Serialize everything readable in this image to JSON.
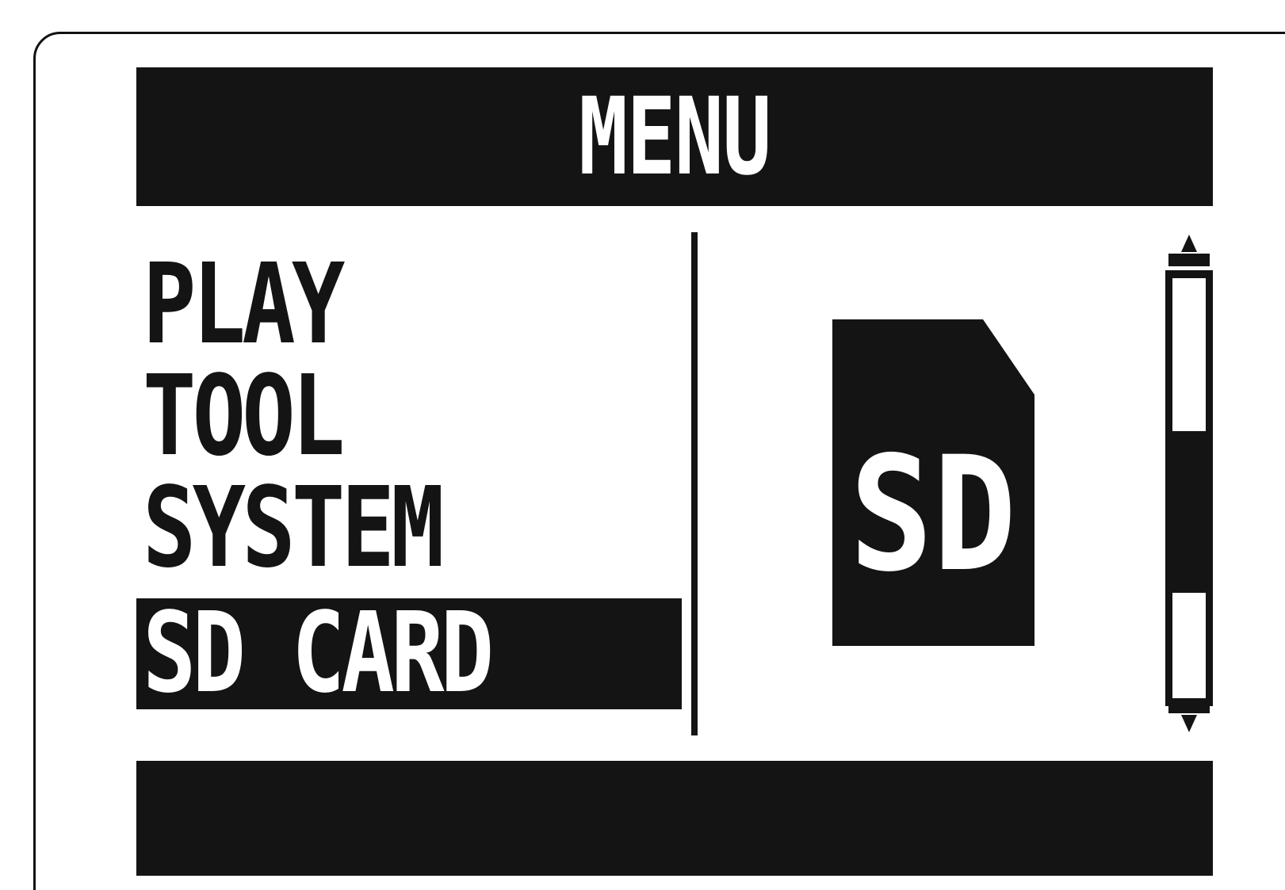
{
  "header": {
    "title": "MENU"
  },
  "menu": {
    "items": [
      {
        "label": "PLAY",
        "selected": false
      },
      {
        "label": "TOOL",
        "selected": false
      },
      {
        "label": "SYSTEM",
        "selected": false
      },
      {
        "label": "SD CARD",
        "selected": true
      }
    ]
  },
  "preview": {
    "icon": "sd-card-icon",
    "icon_text": "SD"
  },
  "scrollbar": {
    "up_icon": "arrow-up-icon",
    "down_icon": "arrow-down-icon"
  },
  "colors": {
    "foreground": "#141414",
    "background": "#ffffff"
  }
}
